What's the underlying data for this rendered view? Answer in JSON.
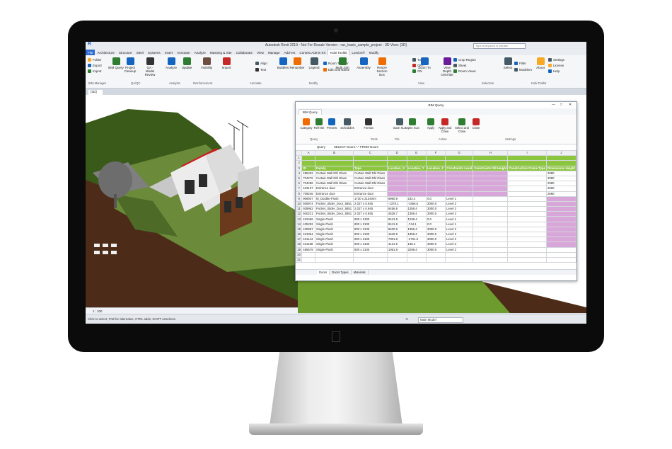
{
  "revit": {
    "window_title": "Autodesk Revit 2019 - Not For Resale Version - rac_basic_sample_project - 3D View: {3D}",
    "search_placeholder": "Type a keyword or phrase",
    "logo": "R",
    "tabs": [
      "File",
      "Architecture",
      "Structure",
      "Steel",
      "Systems",
      "Insert",
      "Annotate",
      "Analyze",
      "Massing & Site",
      "Collaborate",
      "View",
      "Manage",
      "Add-Ins",
      "Contest Admin Kit",
      "Kobi Toolkit",
      "Lumion®",
      "Modify"
    ],
    "active_tab": "Kobi Toolkit",
    "ribbon_buttons": [
      {
        "label": "BIM Query",
        "color": "#2e7d32"
      },
      {
        "label": "Project Cleanup",
        "color": "#1565c0"
      },
      {
        "label": "QA - Model Review",
        "color": "#333333"
      },
      {
        "label": "Analyze",
        "color": "#1565c0"
      },
      {
        "label": "Update",
        "color": "#2e7d32"
      },
      {
        "label": "Visibility",
        "color": "#6d4c41"
      },
      {
        "label": "Import",
        "color": "#c62828"
      },
      {
        "label": "Bubbles",
        "color": "#1565c0"
      },
      {
        "label": "Renumber",
        "color": "#ef6c00"
      },
      {
        "label": "Legend",
        "color": "#455a64"
      },
      {
        "label": "Multi Join",
        "color": "#2e7d32"
      },
      {
        "label": "Assembly",
        "color": "#1565c0"
      },
      {
        "label": "Resize Section Box",
        "color": "#ef6c00"
      },
      {
        "label": "Zoom To",
        "color": "#1565c0"
      },
      {
        "label": "View Depth Override",
        "color": "#6a1b9a"
      },
      {
        "label": "Select",
        "color": "#455a64"
      },
      {
        "label": "About",
        "color": "#f9a825"
      }
    ],
    "ribbon_small": {
      "bim_manager": [
        "Folder",
        "Export",
        "Import"
      ],
      "annotate": [
        "Align",
        "Text"
      ],
      "modify": [
        "Room To Floor",
        "Edit Grid Name"
      ],
      "view_toggle": [
        "Toggle",
        "OFF",
        "ON"
      ],
      "crop": [
        "Crop Region",
        "Sheet",
        "Room Views"
      ],
      "filter": [
        "Filter",
        "Modelers"
      ],
      "settings": [
        "Settings",
        "License",
        "Help"
      ]
    },
    "panels": [
      "BIM Manager",
      "QA/QC",
      "Analysis",
      "Reinforcement",
      "Annotate",
      "Modify",
      "View",
      "Selection",
      "Kobi Toolkit"
    ],
    "view_tab": "{3D}",
    "scale": "1 : 100",
    "status_text": "Click to select, TAB for alternates, CTRL adds, SHIFT unselects.",
    "status_model": "Main Model",
    "status_zero": ":0"
  },
  "bim_query": {
    "title": "BIM Query",
    "tab": "BIM Query",
    "buttons": [
      {
        "label": "Category",
        "color": "#ef6c00"
      },
      {
        "label": "Refresh",
        "color": "#2e7d32"
      },
      {
        "label": "Presets",
        "color": "#1565c0"
      },
      {
        "label": "Schedules",
        "color": "#455a64"
      },
      {
        "label": "Format",
        "color": "#333333"
      },
      {
        "label": "Save XLS",
        "color": "#455a64"
      },
      {
        "label": "Open XLS",
        "color": "#2e7d32"
      },
      {
        "label": "Apply",
        "color": "#2e7d32"
      },
      {
        "label": "Apply and Close",
        "color": "#c62828"
      },
      {
        "label": "Select and Close",
        "color": "#2e7d32"
      },
      {
        "label": "Close",
        "color": "#c62828"
      }
    ],
    "groups": [
      "Query",
      "Tools",
      "File",
      "Action",
      "Settings"
    ],
    "query_label": "Query",
    "query_text": "SELECT Doors.*.* FROM Doors",
    "column_letters": [
      "A",
      "B",
      "C",
      "D",
      "E",
      "F",
      "G",
      "H",
      "I",
      "J"
    ],
    "header_row1": [
      "",
      "",
      "",
      "",
      "",
      "",
      "",
      "",
      "",
      ""
    ],
    "header_row3": [
      "ID",
      "Family",
      "Type",
      "Location_X",
      "Location_Y",
      "Location_Z",
      "Constraints Level",
      "Constraints Sill Height",
      "Construction Frame Type",
      "Dimensions Height"
    ],
    "rows": [
      {
        "n": "4",
        "cells": [
          "485452",
          "Curtain Wall Dbl Glass",
          "Curtain Wall Dbl Glass",
          "",
          "",
          "",
          "",
          "",
          "",
          "2080"
        ]
      },
      {
        "n": "5",
        "cells": [
          "704276",
          "Curtain Wall Dbl Glass",
          "Curtain Wall Dbl Glass",
          "",
          "",
          "",
          "",
          "",
          "",
          "2080"
        ]
      },
      {
        "n": "6",
        "cells": [
          "704286",
          "Curtain Wall Dbl Glass",
          "Curtain Wall Dbl Glass",
          "",
          "",
          "",
          "",
          "",
          "",
          "2080"
        ]
      },
      {
        "n": "7",
        "cells": [
          "423107",
          "Entrance door",
          "Entrance door",
          "",
          "",
          "",
          "",
          "",
          "",
          "2660"
        ]
      },
      {
        "n": "8",
        "cells": [
          "709246",
          "Entrance door",
          "Entrance door",
          "",
          "",
          "",
          "",
          "",
          "",
          "2660"
        ]
      },
      {
        "n": "9",
        "cells": [
          "906937",
          "M_Double-Flush",
          "1730 x 2134mm",
          "6960.9",
          "242.4",
          "0.0",
          "Level 1",
          "",
          "",
          ""
        ]
      },
      {
        "n": "10",
        "cells": [
          "505974",
          "Pocket_Slider_Door_5851",
          "2.027 x 0.945",
          "-1378.1",
          "-1556.6",
          "3000.0",
          "Level 2",
          "",
          "",
          ""
        ]
      },
      {
        "n": "11",
        "cells": [
          "939962",
          "Pocket_Slider_Door_5851",
          "2.027 x 0.945",
          "6456.8",
          "1358.4",
          "3000.0",
          "Level 2",
          "",
          "",
          ""
        ]
      },
      {
        "n": "12",
        "cells": [
          "940221",
          "Pocket_Slider_Door_5851",
          "2.027 x 0.945",
          "4529.7",
          "1358.4",
          "3000.0",
          "Level 2",
          "",
          "",
          ""
        ]
      },
      {
        "n": "13",
        "cells": [
          "422466",
          "Single-Flush",
          "800 x 2100",
          "9441.9",
          "1238.4",
          "0.0",
          "Level 1",
          "",
          "",
          ""
        ]
      },
      {
        "n": "14",
        "cells": [
          "425292",
          "Single-Flush",
          "800 x 2100",
          "9441.9",
          "-744.1",
          "0.0",
          "Level 1",
          "",
          "",
          ""
        ]
      },
      {
        "n": "15",
        "cells": [
          "430997",
          "Single-Flush",
          "800 x 2100",
          "9400.9",
          "1358.4",
          "3000.0",
          "Level 2",
          "",
          "",
          ""
        ]
      },
      {
        "n": "16",
        "cells": [
          "431064",
          "Single-Flush",
          "800 x 2100",
          "1640.9",
          "1358.4",
          "3000.0",
          "Level 2",
          "",
          "",
          ""
        ]
      },
      {
        "n": "17",
        "cells": [
          "431144",
          "Single-Flush",
          "800 x 2100",
          "7001.9",
          "-2701.6",
          "3000.0",
          "Level 2",
          "",
          "",
          ""
        ]
      },
      {
        "n": "18",
        "cells": [
          "431198",
          "Single-Flush",
          "800 x 2100",
          "4121.9",
          "138.4",
          "3000.0",
          "Level 2",
          "",
          "",
          ""
        ]
      },
      {
        "n": "19",
        "cells": [
          "485679",
          "Single-Flush",
          "800 x 2100",
          "1061.9",
          "2298.4",
          "3000.0",
          "Level 2",
          "",
          "",
          ""
        ]
      },
      {
        "n": "20",
        "cells": [
          "",
          "",
          "",
          "",
          "",
          "",
          "",
          "",
          "",
          ""
        ]
      },
      {
        "n": "21",
        "cells": [
          "",
          "",
          "",
          "",
          "",
          "",
          "",
          "",
          "",
          ""
        ]
      }
    ],
    "sheets": [
      "Doors",
      "Doors Types",
      "Materials"
    ],
    "active_sheet": "Doors",
    "colors": {
      "header_green": "#8cc63f",
      "highlight_pink": "#d9a6d9"
    }
  }
}
